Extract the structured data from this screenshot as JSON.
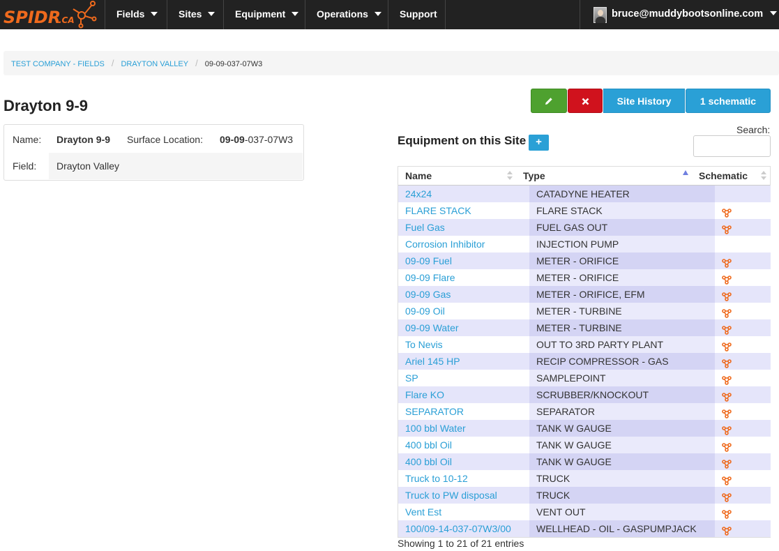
{
  "brand": {
    "logo_text": "SPIDR.CA",
    "accent": "#ef6a1d"
  },
  "nav": {
    "items": [
      {
        "label": "Fields"
      },
      {
        "label": "Sites"
      },
      {
        "label": "Equipment"
      },
      {
        "label": "Operations"
      },
      {
        "label": "Support"
      }
    ],
    "user_email": "bruce@muddybootsonline.com"
  },
  "breadcrumb": {
    "items": [
      "TEST COMPANY - FIELDS",
      "DRAYTON VALLEY"
    ],
    "current": "09-09-037-07W3"
  },
  "page_title": "Drayton 9-9",
  "actions": {
    "edit_icon": "pencil-icon",
    "delete_icon": "times-icon",
    "history_label": "Site History",
    "schematic_label": "1 schematic"
  },
  "site": {
    "name_label": "Name:",
    "name_value": "Drayton 9-9",
    "surface_label": "Surface Location:",
    "surface_bold": "09-09",
    "surface_rest": "-037-07W3",
    "field_label": "Field:",
    "field_value": "Drayton Valley"
  },
  "equipment": {
    "title": "Equipment on this Site",
    "add_label": "+",
    "search_label": "Search:",
    "search_value": "",
    "columns": [
      "Name",
      "Type",
      "Schematic"
    ],
    "rows": [
      {
        "name": "24x24",
        "type": "CATADYNE HEATER",
        "schematic": false
      },
      {
        "name": "FLARE STACK",
        "type": "FLARE STACK",
        "schematic": true
      },
      {
        "name": "Fuel Gas",
        "type": "FUEL GAS OUT",
        "schematic": true
      },
      {
        "name": "Corrosion Inhibitor",
        "type": "INJECTION PUMP",
        "schematic": false
      },
      {
        "name": "09-09 Fuel",
        "type": "METER - ORIFICE",
        "schematic": true
      },
      {
        "name": "09-09 Flare",
        "type": "METER - ORIFICE",
        "schematic": true
      },
      {
        "name": "09-09 Gas",
        "type": "METER - ORIFICE, EFM",
        "schematic": true
      },
      {
        "name": "09-09 Oil",
        "type": "METER - TURBINE",
        "schematic": true
      },
      {
        "name": "09-09 Water",
        "type": "METER - TURBINE",
        "schematic": true
      },
      {
        "name": "To Nevis",
        "type": "OUT TO 3RD PARTY PLANT",
        "schematic": true
      },
      {
        "name": "Ariel 145 HP",
        "type": "RECIP COMPRESSOR - GAS",
        "schematic": true
      },
      {
        "name": "SP",
        "type": "SAMPLEPOINT",
        "schematic": true
      },
      {
        "name": "Flare KO",
        "type": "SCRUBBER/KNOCKOUT",
        "schematic": true
      },
      {
        "name": "SEPARATOR",
        "type": "SEPARATOR",
        "schematic": true
      },
      {
        "name": "100 bbl Water",
        "type": "TANK W GAUGE",
        "schematic": true
      },
      {
        "name": "400 bbl Oil",
        "type": "TANK W GAUGE",
        "schematic": true
      },
      {
        "name": "400 bbl Oil",
        "type": "TANK W GAUGE",
        "schematic": true
      },
      {
        "name": "Truck to 10-12",
        "type": "TRUCK",
        "schematic": true
      },
      {
        "name": "Truck to PW disposal",
        "type": "TRUCK",
        "schematic": true
      },
      {
        "name": "Vent Est",
        "type": "VENT OUT",
        "schematic": true
      },
      {
        "name": "100/09-14-037-07W3/00",
        "type": "WELLHEAD - OIL - GASPUMPJACK",
        "schematic": true
      }
    ],
    "info": "Showing 1 to 21 of 21 entries"
  }
}
